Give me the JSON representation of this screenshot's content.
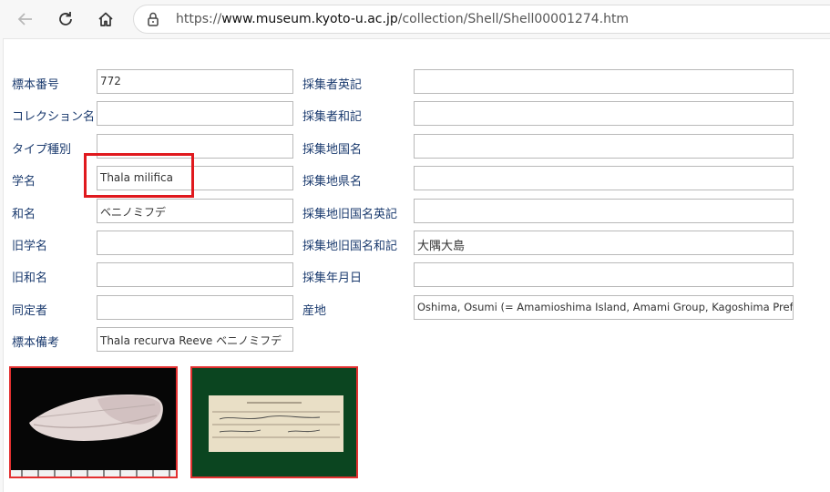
{
  "browser": {
    "url_prefix": "https://",
    "url_domain": "www.museum.kyoto-u.ac.jp",
    "url_path": "/collection/Shell/Shell00001274.htm",
    "icons": {
      "back": "back-arrow-icon",
      "reload": "reload-icon",
      "home": "home-icon",
      "lock": "lock-icon"
    }
  },
  "left_fields": [
    {
      "label": "標本番号",
      "value": "772"
    },
    {
      "label": "コレクション名",
      "value": ""
    },
    {
      "label": "タイプ種別",
      "value": ""
    },
    {
      "label": "学名",
      "value": "Thala milifica"
    },
    {
      "label": "和名",
      "value": "ベニノミフデ"
    },
    {
      "label": "旧学名",
      "value": ""
    },
    {
      "label": "旧和名",
      "value": ""
    },
    {
      "label": "同定者",
      "value": ""
    },
    {
      "label": "標本備考",
      "value": "Thala recurva Reeve ベニノミフデ"
    }
  ],
  "right_fields": [
    {
      "label": "採集者英記",
      "value": ""
    },
    {
      "label": "採集者和記",
      "value": ""
    },
    {
      "label": "採集地国名",
      "value": ""
    },
    {
      "label": "採集地県名",
      "value": ""
    },
    {
      "label": "採集地旧国名英記",
      "value": ""
    },
    {
      "label": "採集地旧国名和記",
      "value": "大隅大島"
    },
    {
      "label": "採集年月日",
      "value": ""
    },
    {
      "label": "産地",
      "value": "Oshima, Osumi (= Amamioshima Island, Amami Group, Kagoshima Pref.)"
    }
  ],
  "images": [
    {
      "name": "shell-photo"
    },
    {
      "name": "specimen-label-photo"
    }
  ],
  "colors": {
    "label_text": "#1a3a6e",
    "highlight": "#e0191e",
    "photo_border": "#e33030"
  }
}
